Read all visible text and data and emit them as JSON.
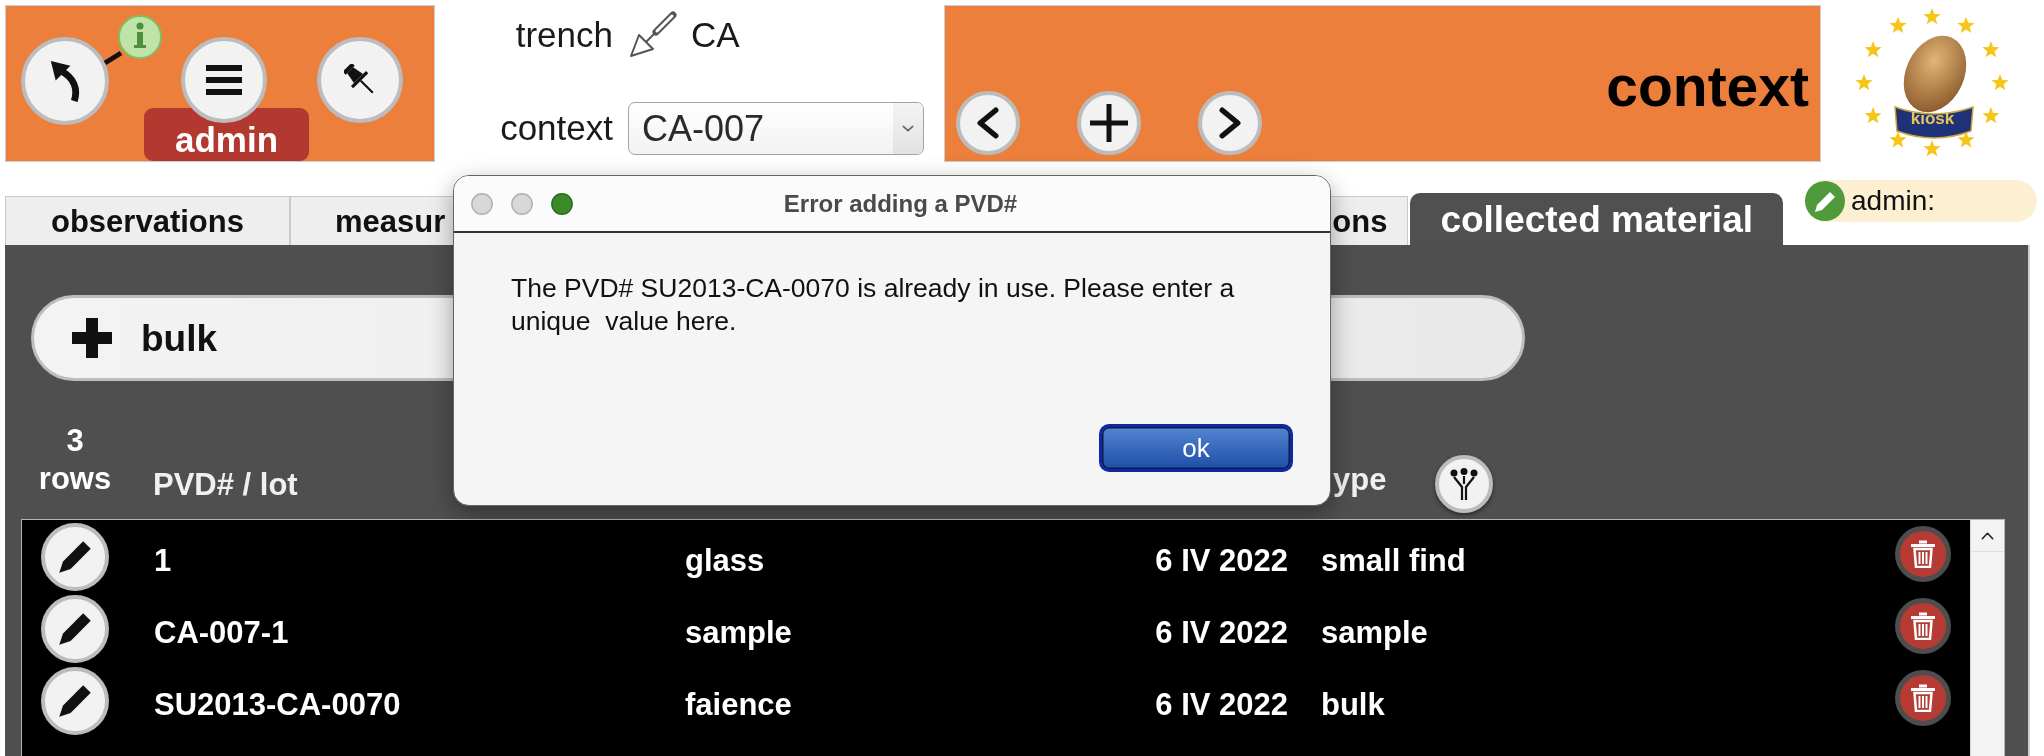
{
  "top_panel": {
    "user_label": "admin"
  },
  "location": {
    "trench_label": "trench",
    "trench_value": "CA",
    "context_label": "context",
    "context_value": "CA-007"
  },
  "record_panel": {
    "title": "context"
  },
  "logo": {
    "text": "kiosk"
  },
  "tabs": [
    {
      "label": "observations",
      "selected": false,
      "cut_start": false,
      "cut_end": false
    },
    {
      "label": "measur",
      "selected": false,
      "cut_start": false,
      "cut_end": true
    },
    {
      "label": "ons",
      "selected": false,
      "cut_start": true,
      "cut_end": false
    },
    {
      "label": "collected material",
      "selected": true,
      "cut_start": false,
      "cut_end": false
    }
  ],
  "user_pill": {
    "label": "admin:"
  },
  "add_button": {
    "label": "bulk"
  },
  "table": {
    "row_count": "3",
    "row_count_label": "rows",
    "columns": [
      {
        "label": "PVD# / lot",
        "filterable": false
      },
      {
        "label": "ype",
        "filterable": true
      }
    ],
    "rows": [
      {
        "pvd": "1",
        "material": "glass",
        "date": "6 IV 2022",
        "type": "small find"
      },
      {
        "pvd": "CA-007-1",
        "material": "sample",
        "date": "6 IV 2022",
        "type": "sample"
      },
      {
        "pvd": "SU2013-CA-0070",
        "material": "faience",
        "date": "6 IV 2022",
        "type": "bulk"
      }
    ]
  },
  "dialog": {
    "title": "Error adding a PVD#",
    "message": "The PVD# SU2013-CA-0070 is already in use. Please enter a unique  value here.",
    "button": "ok"
  }
}
